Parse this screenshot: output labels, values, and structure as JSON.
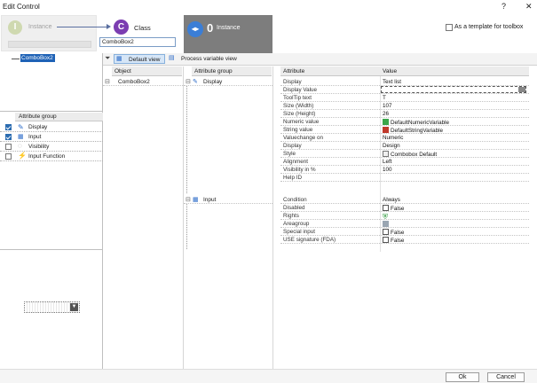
{
  "window": {
    "title": "Edit Control",
    "help": "?",
    "close": "✕"
  },
  "steps": {
    "instance_left": {
      "letter": "I",
      "label": "Instance"
    },
    "class": {
      "letter": "C",
      "label": "Class",
      "value": "ComboBox2"
    },
    "instance_count": {
      "count": "0",
      "label": "Instance"
    }
  },
  "template_checkbox": {
    "label": "As a template for toolbox",
    "checked": false
  },
  "tree": {
    "item": "ComboBox2"
  },
  "attribute_groups": {
    "header": "Attribute group",
    "items": [
      {
        "label": "Display",
        "checked": true
      },
      {
        "label": "Input",
        "checked": true
      },
      {
        "label": "Visibility",
        "checked": false
      },
      {
        "label": "Input Function",
        "checked": false
      }
    ]
  },
  "toolbar": {
    "default_view": "Default view",
    "process_view": "Process variable view"
  },
  "object_col": {
    "header": "Object",
    "item": "ComboBox2"
  },
  "group_col": {
    "header": "Attribute group",
    "display": "Display",
    "input": "Input"
  },
  "attr_table": {
    "header_attr": "Attribute",
    "header_value": "Value",
    "rows": [
      {
        "attr": "Display",
        "value": "Text list"
      },
      {
        "attr": "Display Value",
        "value": ""
      },
      {
        "attr": "ToolTip text",
        "value": "T"
      },
      {
        "attr": "Size (Width)",
        "value": "107"
      },
      {
        "attr": "Size (Height)",
        "value": "26"
      },
      {
        "attr": "Numeric value",
        "value": "DefaultNumericVariable"
      },
      {
        "attr": "String value",
        "value": "DefaultStringVariable"
      },
      {
        "attr": "Valuechange on",
        "value": "Numeric"
      },
      {
        "attr": "Display",
        "value": "Design"
      },
      {
        "attr": "Style",
        "value": "Combobox Default"
      },
      {
        "attr": "Alignment",
        "value": "Left"
      },
      {
        "attr": "Visibility in %",
        "value": "100"
      },
      {
        "attr": "Help ID",
        "value": ""
      },
      {
        "attr": "Condition",
        "value": "Always"
      },
      {
        "attr": "Disabled",
        "value": "False"
      },
      {
        "attr": "Rights",
        "value": ""
      },
      {
        "attr": "Areagroup",
        "value": ""
      },
      {
        "attr": "Special input",
        "value": "False"
      },
      {
        "attr": "USE signature (FDA)",
        "value": "False"
      }
    ]
  },
  "footer": {
    "ok": "Ok",
    "cancel": "Cancel"
  }
}
